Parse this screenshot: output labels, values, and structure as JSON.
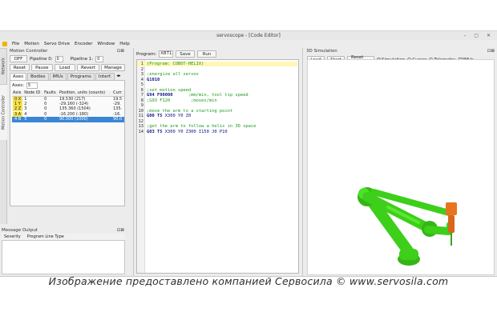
{
  "window": {
    "title": "servoscope - [Code Editor]",
    "controls": "– ▢ ✕"
  },
  "menu": [
    "File",
    "Motion",
    "Servo Drive",
    "Encoder",
    "Window",
    "Help"
  ],
  "vtabs": [
    "Network",
    "Motion Controller"
  ],
  "motion_controller": {
    "title": "Motion Controller",
    "panel_ctrl": "⊡⊠",
    "off_label": "OFF",
    "pipeline0_label": "Pipeline 0:",
    "pipeline0_value": "0",
    "pipeline1_label": "Pipeline 1:",
    "pipeline1_value": "0",
    "buttons": [
      "Reset",
      "Pause",
      "Load",
      "Revert",
      "Manage"
    ],
    "tabs": [
      "Axes",
      "Bodies",
      "IMUs",
      "Programs",
      "Interf."
    ],
    "tab_more": "◂▸",
    "axes_label": "Axes:",
    "axes_value": "5",
    "table_headers": [
      "Axis",
      "Node ID",
      "Faults",
      "Position, units (counts)",
      "Curr"
    ],
    "rows": [
      {
        "axis": "0 X",
        "node": "1",
        "faults": "0",
        "position": "19.530 (217)",
        "curr": "19.5"
      },
      {
        "axis": "1 Y",
        "node": "2",
        "faults": "0",
        "position": "-29.160 (-324)",
        "curr": "-29."
      },
      {
        "axis": "2 Z",
        "node": "3",
        "faults": "0",
        "position": "135.360 (1504)",
        "curr": "135."
      },
      {
        "axis": "3 A",
        "node": "4",
        "faults": "0",
        "position": "-16.200 (-180)",
        "curr": "-16."
      },
      {
        "axis": "4 B",
        "node": "5",
        "faults": "0",
        "position": "90.000 (1000)",
        "curr": "90.0"
      }
    ]
  },
  "message_output": {
    "title": "Message Output",
    "panel_ctrl": "⊡⊠",
    "columns": [
      "Severity",
      "Program Line Type"
    ]
  },
  "editor": {
    "program_label": "Program:",
    "program_value": "XBT1",
    "save_label": "Save",
    "run_label": "Run",
    "lines": [
      {
        "n": "1",
        "text": "(Program: COBOT-HELIX)",
        "kind": "highlight"
      },
      {
        "n": "2",
        "text": "",
        "kind": "plain"
      },
      {
        "n": "3",
        "text": ";energize all servos",
        "kind": "comment"
      },
      {
        "n": "4",
        "text": "G1010",
        "kind": "kw"
      },
      {
        "n": "5",
        "text": "",
        "kind": "plain"
      },
      {
        "n": "6",
        "text": ";set motion speed",
        "kind": "comment"
      },
      {
        "n": "7",
        "text": "G94 F90000      ;mm/min, tool tip speed",
        "kind": "mixed",
        "code": "G94 F90000",
        "comment": "      ;mm/min, tool tip speed"
      },
      {
        "n": "8",
        "text": ";G93 F120        ;moves/min",
        "kind": "comment"
      },
      {
        "n": "9",
        "text": "",
        "kind": "plain"
      },
      {
        "n": "10",
        "text": ";move the arm to a starting point",
        "kind": "comment"
      },
      {
        "n": "11",
        "text": "G00 T5 X300 Y0 Z0",
        "kind": "mixed",
        "code": "G00 T5",
        "comment": " X300 Y0 Z0",
        "tailcode": true
      },
      {
        "n": "12",
        "text": "",
        "kind": "plain"
      },
      {
        "n": "13",
        "text": ";get the arm to follow a helix in 3D space",
        "kind": "comment"
      },
      {
        "n": "14",
        "text": "G03 T5 X300 Y0 Z300 I150 J0 P10",
        "kind": "mixed",
        "code": "G03 T5",
        "comment": " X300 Y0 Z300 I150 J0 P10",
        "tailcode": true
      }
    ]
  },
  "simulation": {
    "title": "3D Simulation",
    "panel_ctrl": "⊡⊠",
    "buttons": [
      "Load",
      "Start",
      "Reset View"
    ],
    "options": [
      {
        "label": "Simulation",
        "type": "radio",
        "on": true
      },
      {
        "label": "Cursor",
        "type": "radio",
        "on": false
      },
      {
        "label": "Telemetry",
        "type": "radio",
        "on": false
      },
      {
        "label": "IMUs",
        "type": "check",
        "on": true
      }
    ],
    "robot_color": "#3dcf1a",
    "tool_color": "#e8741e"
  },
  "watermark": "Изображение предоставлено компанией Сервосила © www.servosila.com"
}
